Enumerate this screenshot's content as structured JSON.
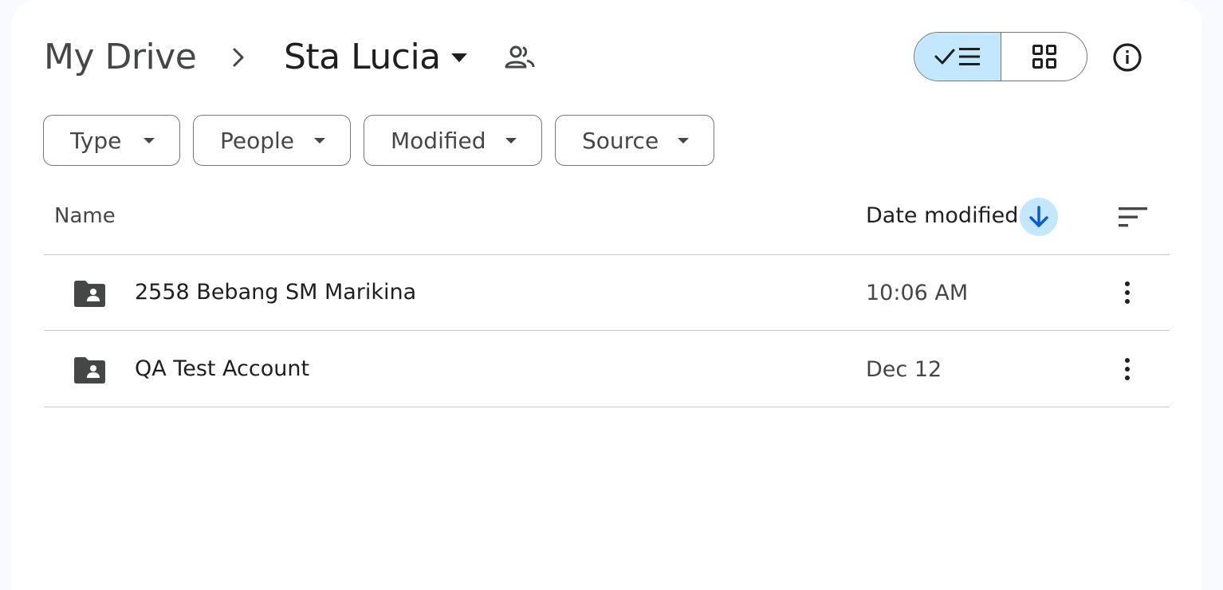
{
  "breadcrumb": {
    "root": "My Drive",
    "current": "Sta Lucia"
  },
  "icons": {
    "breadcrumb_separator": "chevron-right-icon",
    "current_folder_menu": "caret-down-icon",
    "shared_indicator": "people-icon",
    "list_view": "check-list-icon",
    "grid_view": "grid-icon",
    "details": "info-icon",
    "sort_direction": "arrow-down-icon",
    "sort_options": "sort-lines-icon",
    "row_folder": "shared-folder-icon",
    "row_actions": "more-vert-icon"
  },
  "view": {
    "active": "list"
  },
  "filters": [
    {
      "label": "Type"
    },
    {
      "label": "People"
    },
    {
      "label": "Modified"
    },
    {
      "label": "Source"
    }
  ],
  "columns": {
    "name": "Name",
    "date_modified": "Date modified"
  },
  "rows": [
    {
      "name": "2558 Bebang SM Marikina",
      "modified": "10:06 AM"
    },
    {
      "name": "QA Test Account",
      "modified": "Dec 12"
    }
  ],
  "colors": {
    "accent_bg": "#c2e7ff",
    "accent_fg": "#0b57d0",
    "icon": "#444746",
    "border": "#747775",
    "divider": "#c4c7c5"
  }
}
